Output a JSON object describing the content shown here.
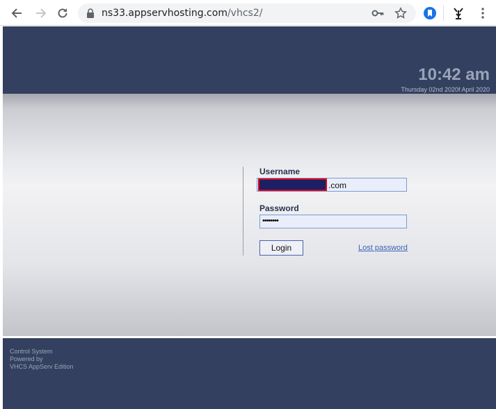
{
  "browser": {
    "url_host": "ns33.appservhosting.com",
    "url_path": "/vhcs2/"
  },
  "header": {
    "time": "10:42 am",
    "date": "Thursday 02nd 2020f April 2020"
  },
  "login": {
    "username_label": "Username",
    "username_value_suffix": ".com",
    "password_label": "Password",
    "password_mask": "••••••••",
    "login_button": "Login",
    "lost_password_link": "Lost password"
  },
  "footer": {
    "line1": "Control System",
    "line2": "Powered by",
    "line3": "VHCS AppServ Edition"
  },
  "colors": {
    "header_bg": "#33405f",
    "redaction": "#1b1f63",
    "redaction_border": "#e0001a",
    "link": "#3a62b8"
  }
}
